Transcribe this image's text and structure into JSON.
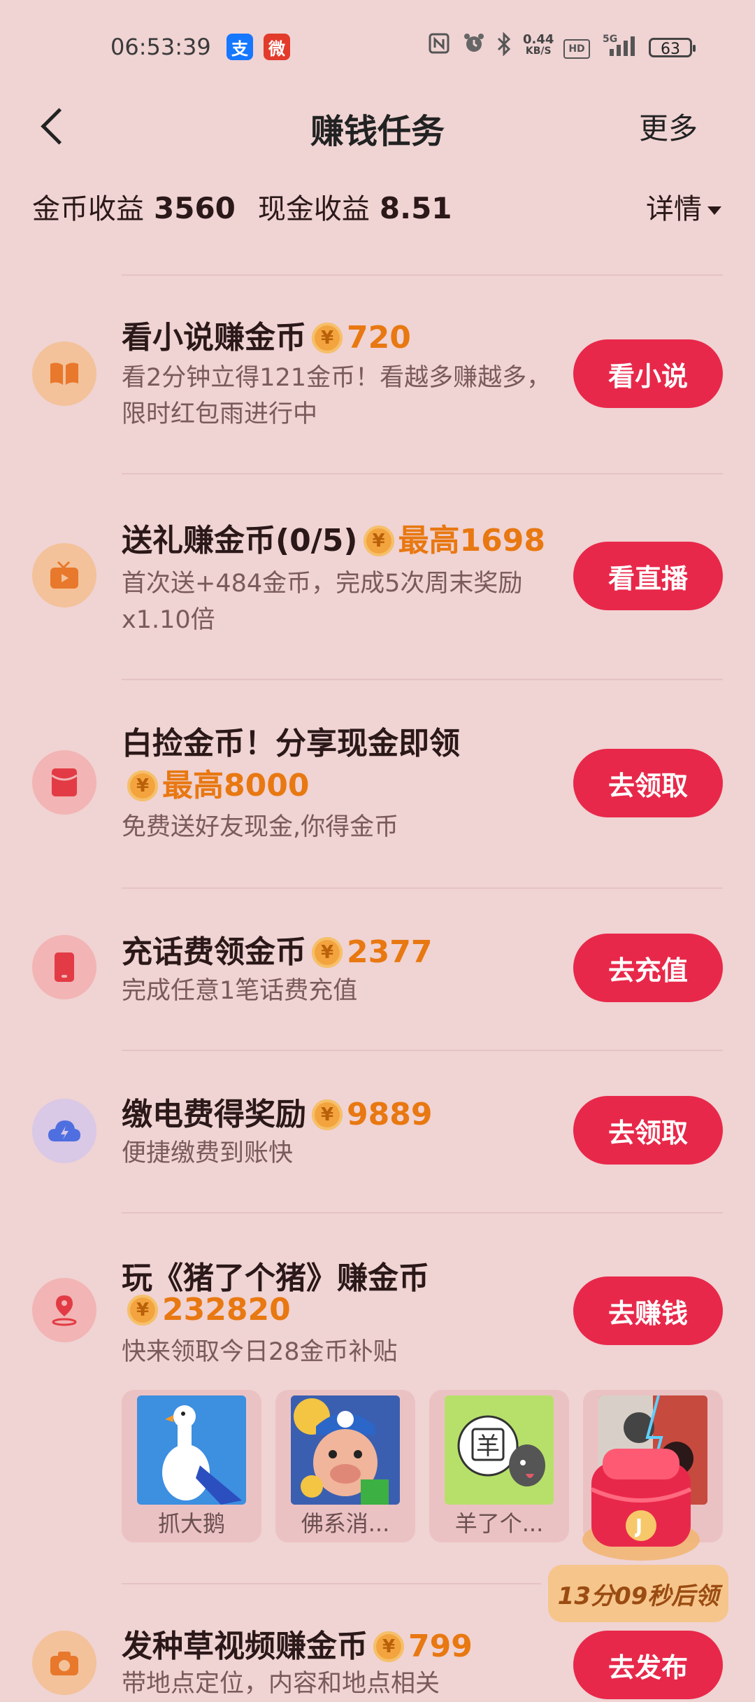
{
  "status_bar": {
    "time": "06:53:39",
    "apps": [
      "支",
      "微"
    ],
    "net_speed": "0.44",
    "net_unit": "KB/S",
    "hd": "HD",
    "network": "5G",
    "battery": "63"
  },
  "header": {
    "title": "赚钱任务",
    "more_label": "更多"
  },
  "earnings": {
    "coin_label": "金币收益",
    "coin_value": "3560",
    "cash_label": "现金收益",
    "cash_value": "8.51",
    "detail_label": "详情"
  },
  "tasks": [
    {
      "title": "看小说赚金币",
      "reward": "720",
      "desc": "看2分钟立得121金币！看越多赚越多，限时红包雨进行中",
      "button": "看小说",
      "icon": "book-icon",
      "icon_color": "#f3c29a",
      "icon_fg": "#e8782c"
    },
    {
      "title": "送礼赚金币(0/5)",
      "reward": "最高1698",
      "desc": "首次送+484金币，完成5次周末奖励x1.10倍",
      "button": "看直播",
      "icon": "tv-icon",
      "icon_color": "#f3c29a",
      "icon_fg": "#e8782c"
    },
    {
      "title": "白捡金币！分享现金即领",
      "reward": "最高8000",
      "desc": "免费送好友现金,你得金币",
      "button": "去领取",
      "icon": "red-envelope-icon",
      "icon_color": "#f2b4b4",
      "icon_fg": "#e23b45"
    },
    {
      "title": "充话费领金币",
      "reward": "2377",
      "desc": "完成任意1笔话费充值",
      "button": "去充值",
      "icon": "phone-icon",
      "icon_color": "#f2b4b4",
      "icon_fg": "#e23b45"
    },
    {
      "title": "缴电费得奖励",
      "reward": "9889",
      "desc": "便捷缴费到账快",
      "button": "去领取",
      "icon": "electricity-cloud-icon",
      "icon_color": "#d9c8e6",
      "icon_fg": "#4f6fe0"
    },
    {
      "title": "玩《猪了个猪》赚金币",
      "reward": "232820",
      "desc": "快来领取今日28金币补贴",
      "button": "去赚钱",
      "icon": "game-pin-icon",
      "icon_color": "#f2b4b4",
      "icon_fg": "#e23b45"
    },
    {
      "title": "发种草视频赚金币",
      "reward": "799",
      "desc": "带地点定位，内容和地点相关",
      "button": "去发布",
      "icon": "camera-icon",
      "icon_color": "#f3c29a",
      "icon_fg": "#e8782c"
    }
  ],
  "games": [
    {
      "name": "抓大鹅",
      "color": "#3d8fe0"
    },
    {
      "name": "佛系消...",
      "color": "#3b5fb0"
    },
    {
      "name": "羊了个...",
      "color": "#b7e06a"
    },
    {
      "name": "",
      "color": "#c64a3e"
    }
  ],
  "floating": {
    "countdown": "13分09秒后领"
  },
  "colors": {
    "background": "#f0d3d3",
    "accent": "#e8284a",
    "reward": "#e87811"
  }
}
